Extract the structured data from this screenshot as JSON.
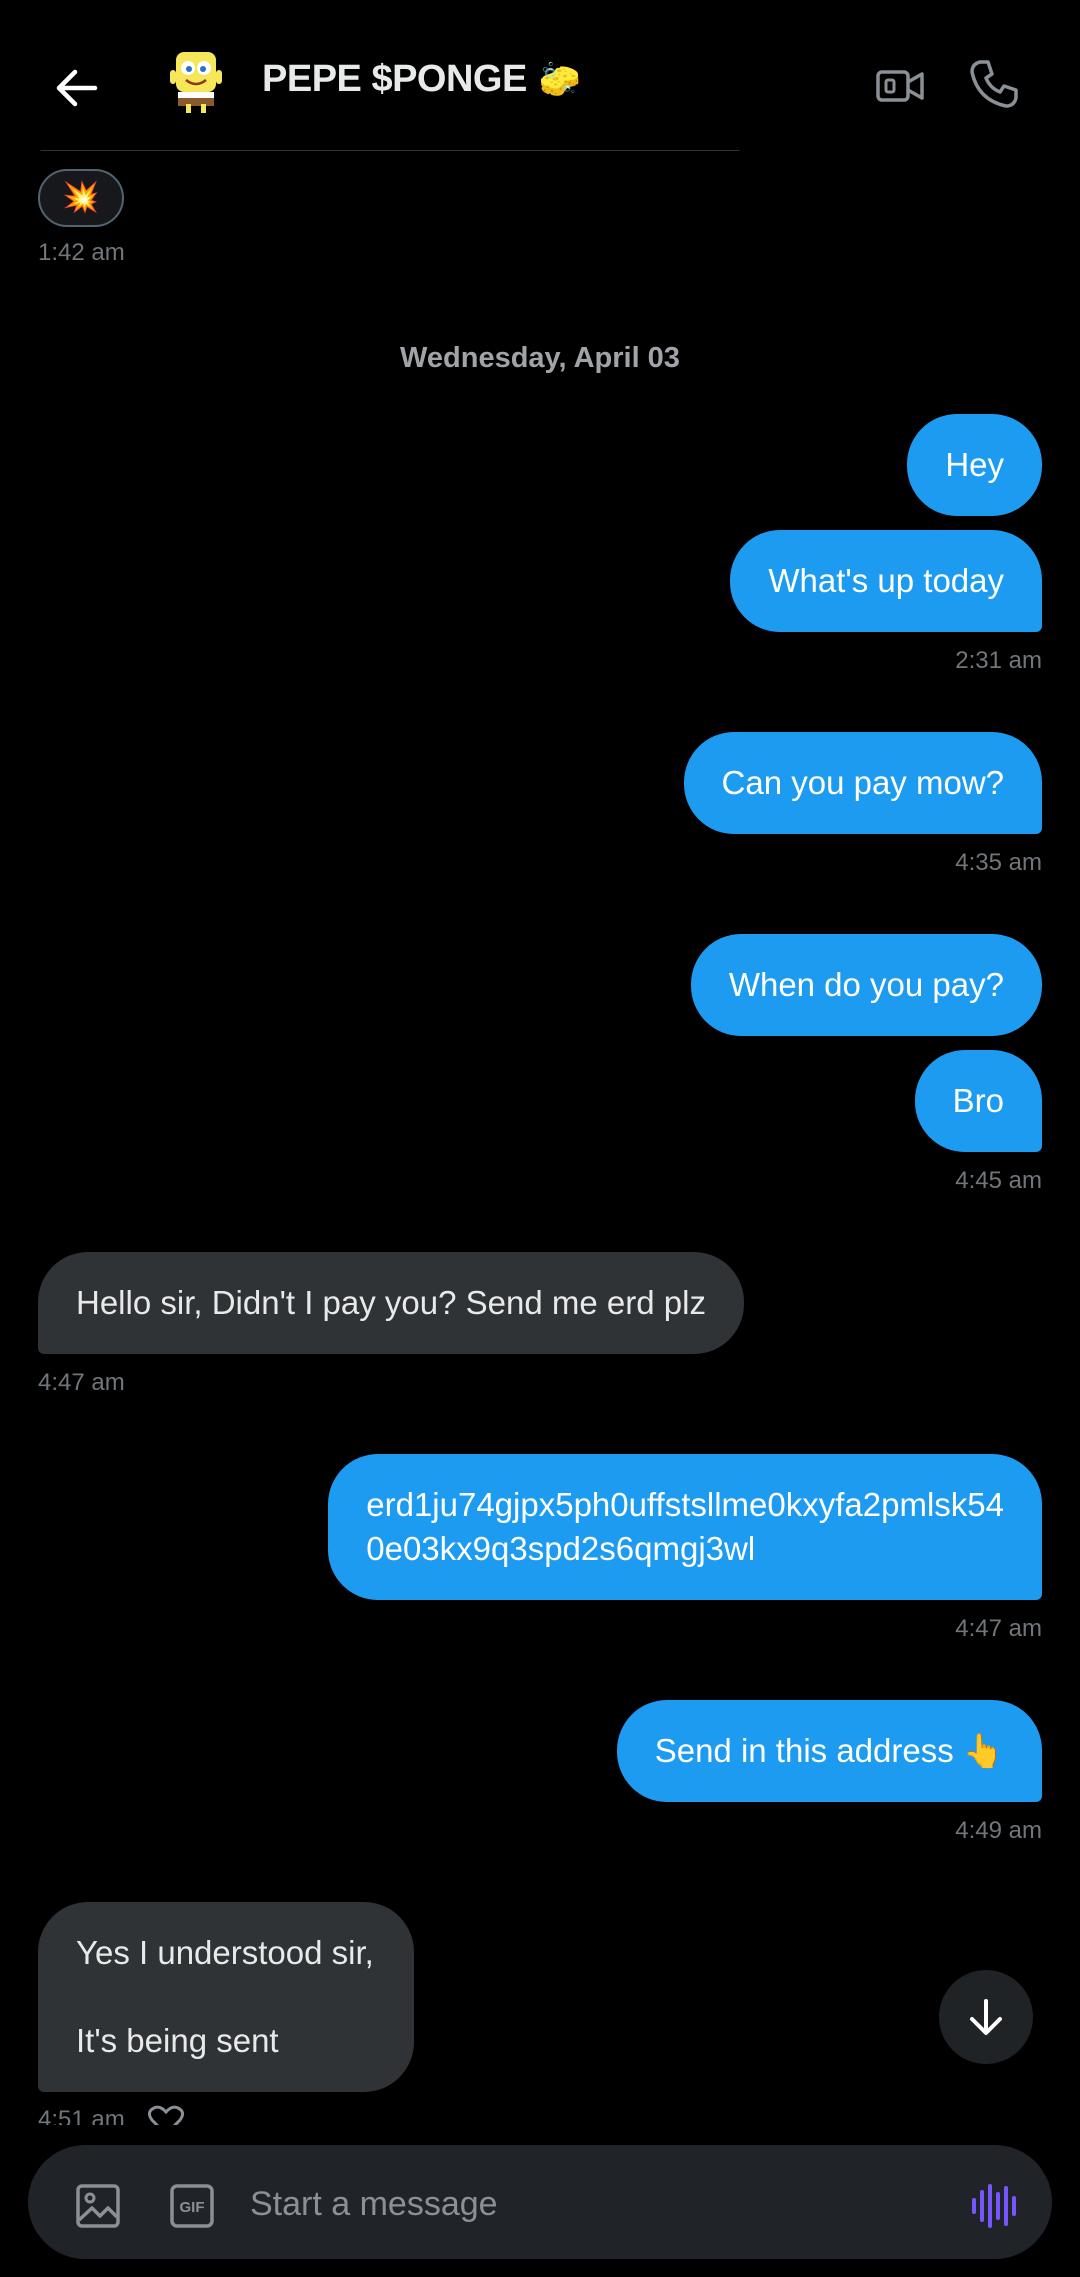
{
  "header": {
    "title": "PEPE $PONGE",
    "title_emoji": "🧽",
    "back_icon": "arrow-left-icon",
    "video_icon": "video-call-icon",
    "call_icon": "phone-icon"
  },
  "colors": {
    "background": "#000000",
    "outgoing_bubble": "#1d9bf0",
    "incoming_bubble": "#2f3336",
    "timestamp": "#71767b",
    "voice_accent": "#7856ff"
  },
  "reaction": {
    "emoji": "💥",
    "time": "1:42 am"
  },
  "date_separator": "Wednesday, April 03",
  "messages": [
    {
      "dir": "out",
      "text": "Hey"
    },
    {
      "dir": "out",
      "text": "What's up today",
      "time": "2:31 am"
    },
    {
      "dir": "out",
      "text": "Can you pay mow?",
      "time": "4:35 am"
    },
    {
      "dir": "out",
      "text": "When do you pay?"
    },
    {
      "dir": "out",
      "text": "Bro",
      "time": "4:45 am"
    },
    {
      "dir": "in",
      "text": "Hello sir, Didn't I pay you? Send me erd plz",
      "time": "4:47 am"
    },
    {
      "dir": "out",
      "line1": "erd1ju74gjpx5ph0uffstsllme0kxyfa2pmlsk54",
      "line2": "0e03kx9q3spd2s6qmgj3wl",
      "time": "4:47 am"
    },
    {
      "dir": "out",
      "text": "Send in this address 👆",
      "time": "4:49 am"
    },
    {
      "dir": "in",
      "line1": "Yes I understood sir,",
      "line2": "It's being sent",
      "time": "4:51 am"
    }
  ],
  "composer": {
    "placeholder": "Start a message",
    "image_icon": "image-icon",
    "gif_icon": "gif-icon",
    "gif_label": "GIF",
    "voice_icon": "voice-waveform-icon"
  },
  "scroll_button_icon": "arrow-down-icon"
}
